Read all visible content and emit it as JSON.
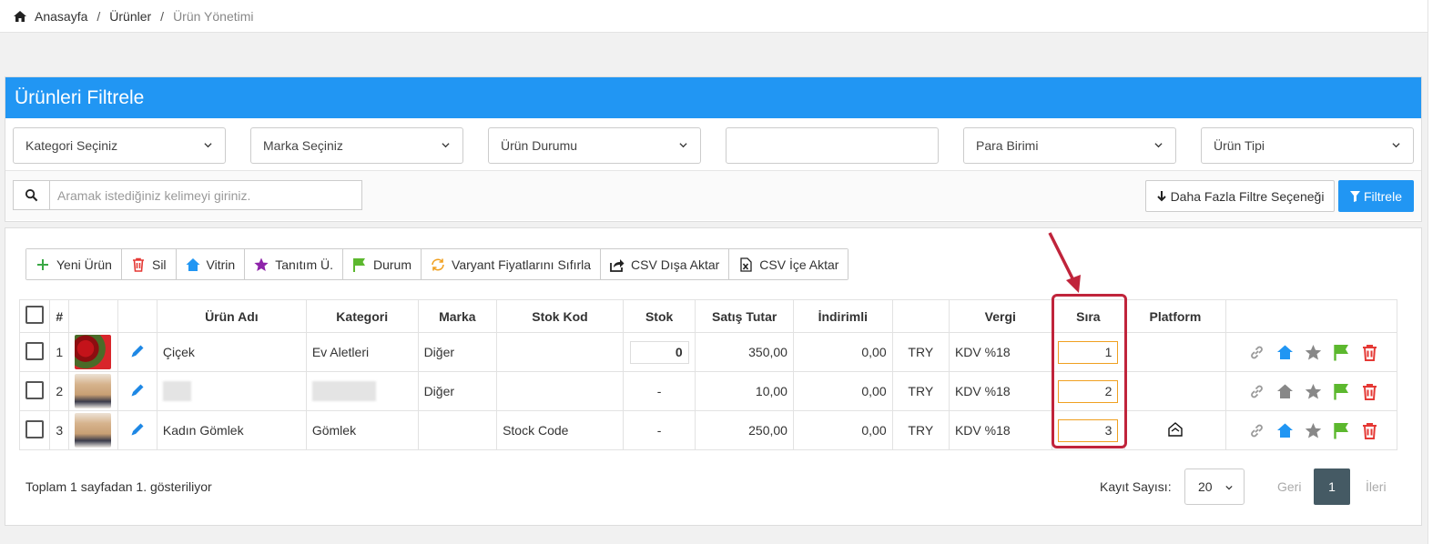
{
  "breadcrumb": {
    "home": "Anasayfa",
    "sep": "/",
    "products": "Ürünler",
    "current": "Ürün Yönetimi"
  },
  "filter": {
    "title": "Ürünleri Filtrele",
    "selects": [
      "Kategori Seçiniz",
      "Marka Seçiniz",
      "Ürün Durumu",
      "",
      "Para Birimi",
      "Ürün Tipi"
    ],
    "search_placeholder": "Aramak istediğiniz kelimeyi giriniz.",
    "more_button": "Daha Fazla Filtre Seçeneği",
    "filter_button": "Filtrele"
  },
  "toolbar": {
    "new": "Yeni Ürün",
    "delete": "Sil",
    "showcase": "Vitrin",
    "promo": "Tanıtım Ü.",
    "status": "Durum",
    "reset_prices": "Varyant Fiyatlarını Sıfırla",
    "csv_export": "CSV Dışa Aktar",
    "csv_import": "CSV İçe Aktar"
  },
  "table": {
    "headers": {
      "no": "#",
      "name": "Ürün Adı",
      "category": "Kategori",
      "brand": "Marka",
      "stock_code": "Stok Kod",
      "stock": "Stok",
      "price": "Satış Tutar",
      "discounted": "İndirimli",
      "tax": "Vergi",
      "order": "Sıra",
      "platform": "Platform"
    },
    "rows": [
      {
        "no": "1",
        "name": "Çiçek",
        "category": "Ev Aletleri",
        "brand": "Diğer",
        "stock_code": "",
        "stock": "0",
        "price": "350,00",
        "discounted": "0,00",
        "currency": "TRY",
        "tax": "KDV %18",
        "order": "1"
      },
      {
        "no": "2",
        "name": "",
        "category": "",
        "brand": "Diğer",
        "stock_code": "",
        "stock": "-",
        "price": "10,00",
        "discounted": "0,00",
        "currency": "TRY",
        "tax": "KDV %18",
        "order": "2"
      },
      {
        "no": "3",
        "name": "Kadın Gömlek",
        "category": "Gömlek",
        "brand": "",
        "stock_code": "Stock Code",
        "stock": "-",
        "price": "250,00",
        "discounted": "0,00",
        "currency": "TRY",
        "tax": "KDV %18",
        "order": "3"
      }
    ]
  },
  "footer": {
    "summary": "Toplam 1 sayfadan 1. gösteriliyor",
    "page_size_label": "Kayıt Sayısı:",
    "page_size": "20",
    "prev": "Geri",
    "current_page": "1",
    "next": "İleri"
  },
  "colors": {
    "primary": "#2196f3",
    "highlight": "#c0243b",
    "order_border": "#f0a020",
    "page_active": "#455a64"
  }
}
